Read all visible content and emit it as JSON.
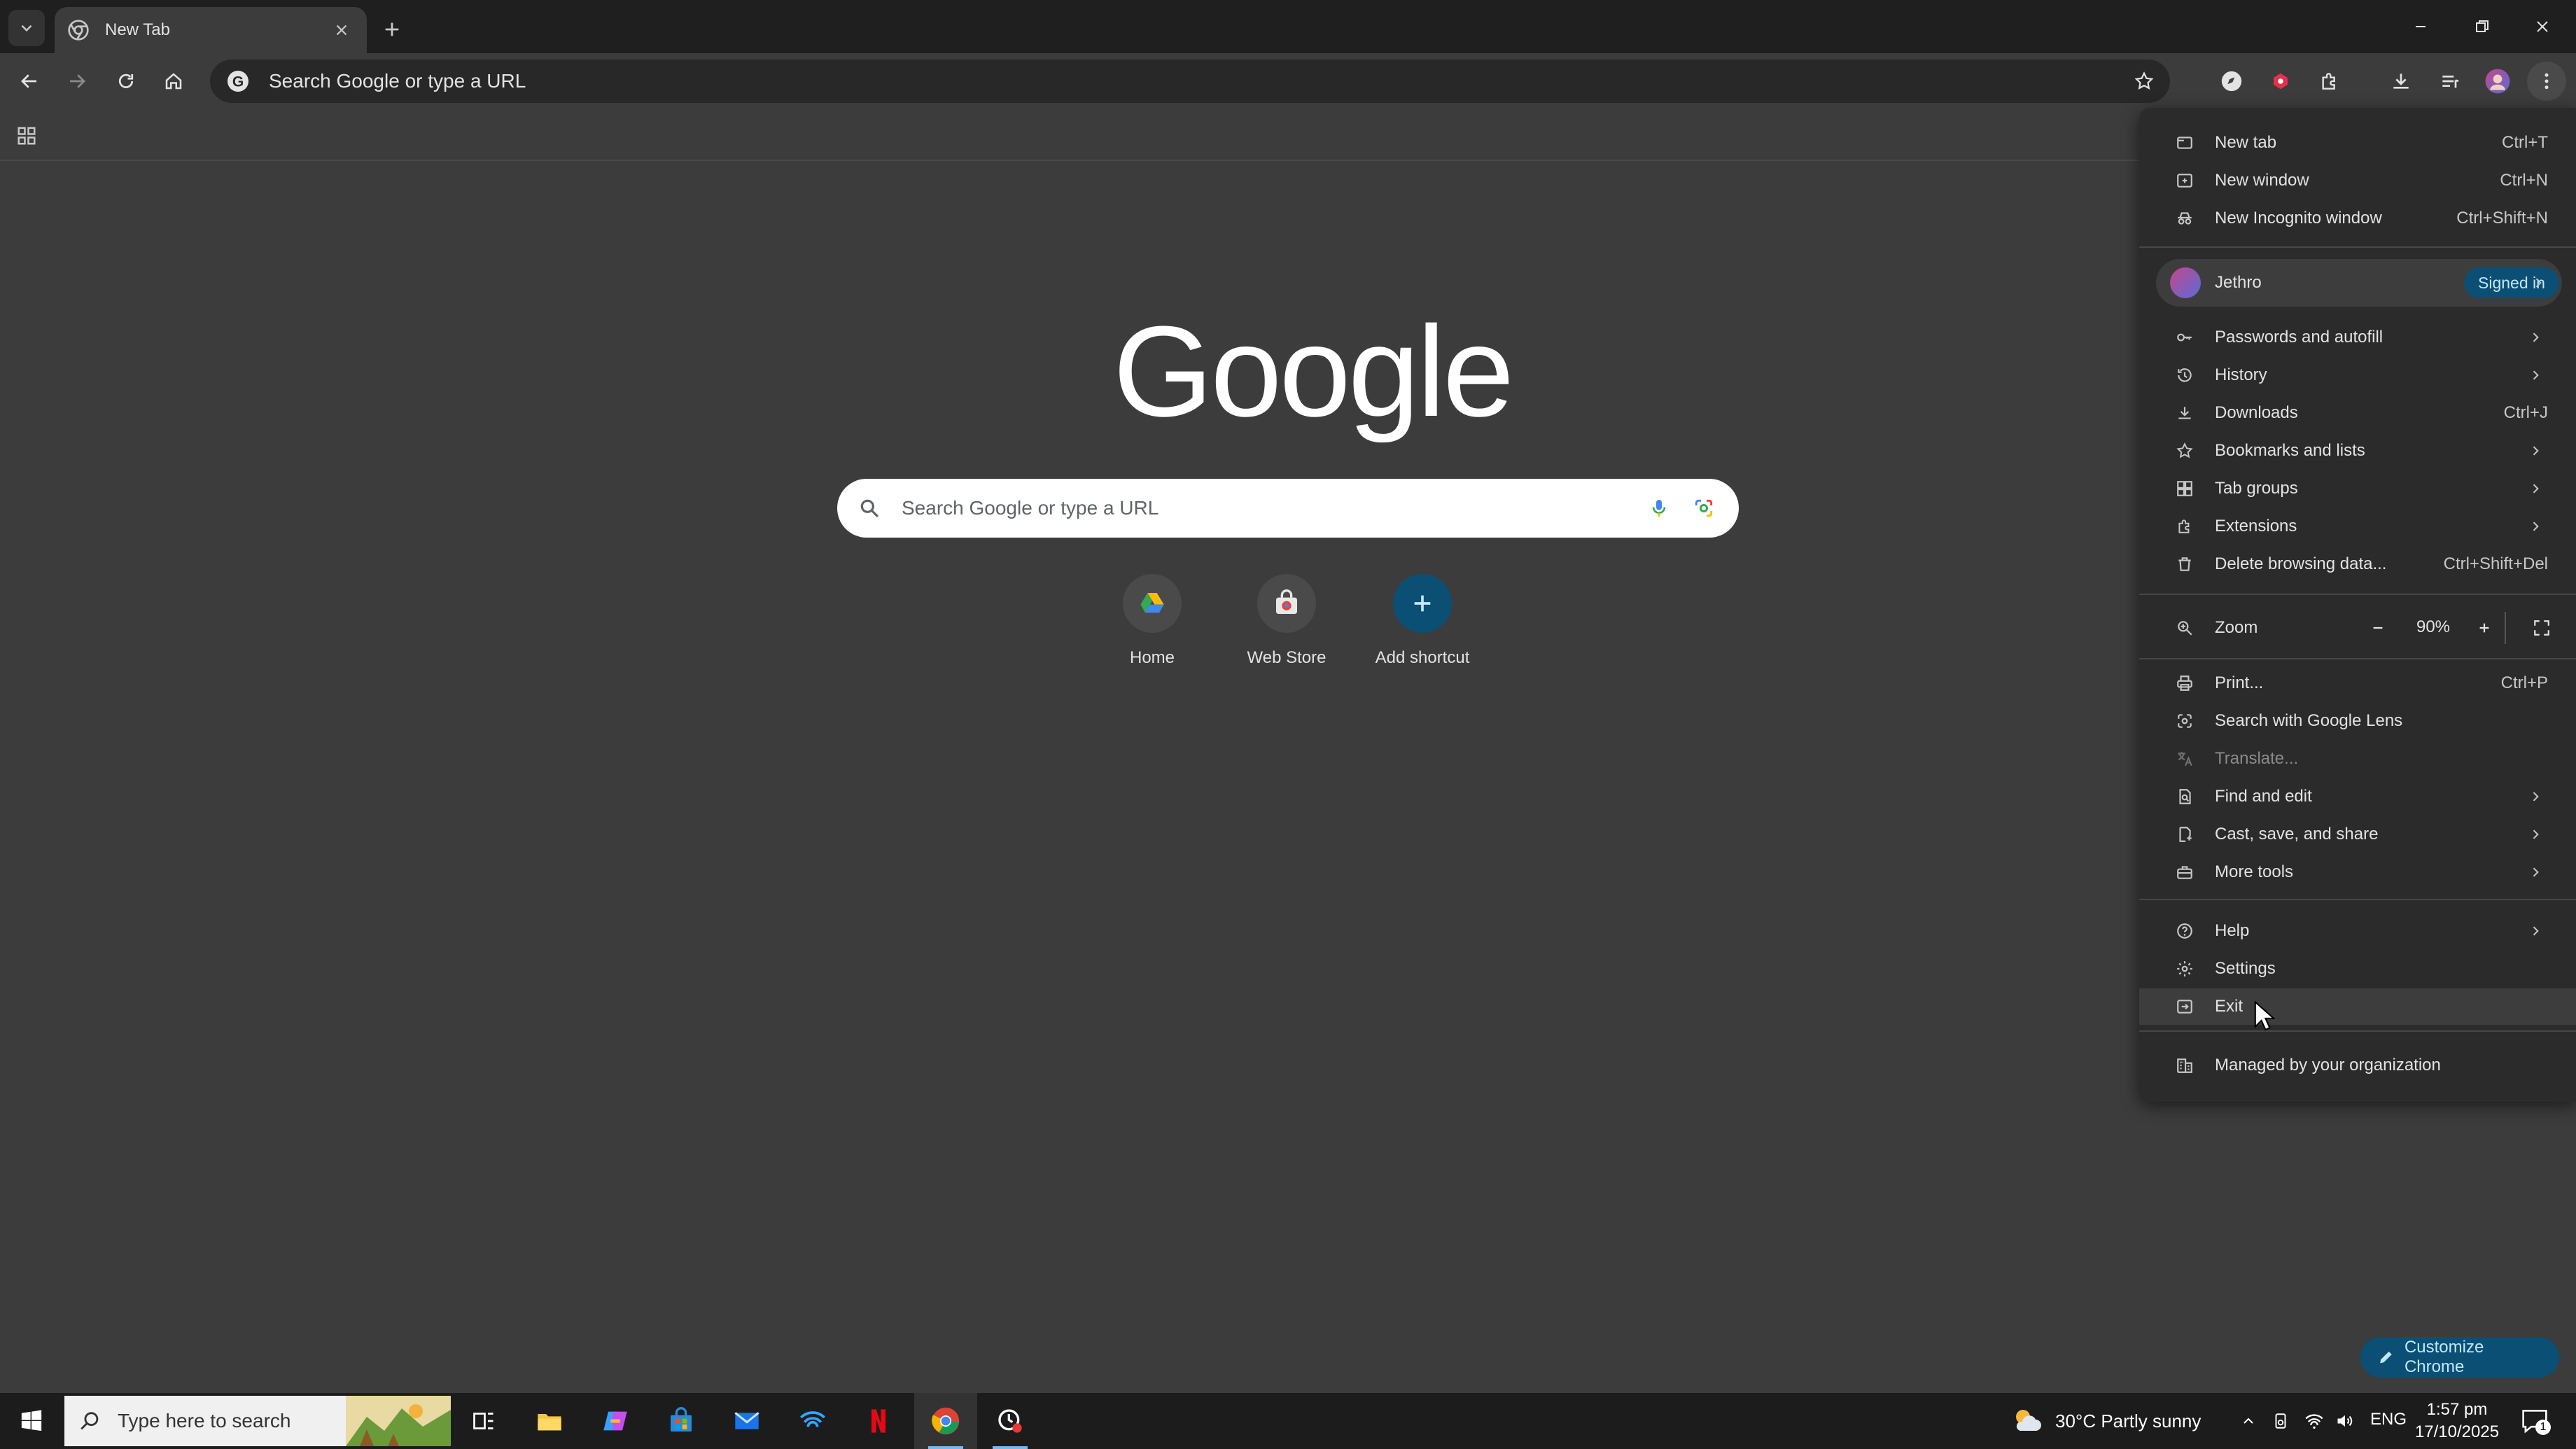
{
  "colors": {
    "frame": "#1f1f1f",
    "toolbar": "#3c3c3c",
    "page": "#3c3c3c",
    "menu": "#2b2b2b",
    "accent": "#0b4f74",
    "accent_text": "#c2e7ff"
  },
  "tab": {
    "title": "New Tab"
  },
  "omnibox": {
    "text": "Search Google or type a URL"
  },
  "ntp": {
    "logo": "Google",
    "search_placeholder": "Search Google or type a URL",
    "shortcuts": [
      {
        "label": "Home",
        "icon": "google-drive-icon"
      },
      {
        "label": "Web Store",
        "icon": "web-store-icon"
      },
      {
        "label": "Add shortcut",
        "icon": "plus-icon"
      }
    ],
    "customize_label": "Customize Chrome"
  },
  "menu": {
    "group1": [
      {
        "label": "New tab",
        "shortcut": "Ctrl+T",
        "icon": "new-tab-icon"
      },
      {
        "label": "New window",
        "shortcut": "Ctrl+N",
        "icon": "new-window-icon"
      },
      {
        "label": "New Incognito window",
        "shortcut": "Ctrl+Shift+N",
        "icon": "incognito-icon"
      }
    ],
    "profile": {
      "name": "Jethro",
      "badge": "Signed in"
    },
    "group2": [
      {
        "label": "Passwords and autofill",
        "shortcut": "",
        "icon": "key-icon"
      },
      {
        "label": "History",
        "shortcut": "",
        "icon": "history-icon"
      },
      {
        "label": "Downloads",
        "shortcut": "Ctrl+J",
        "icon": "download-icon"
      },
      {
        "label": "Bookmarks and lists",
        "shortcut": "",
        "icon": "star-icon"
      },
      {
        "label": "Tab groups",
        "shortcut": "",
        "icon": "tab-groups-icon"
      },
      {
        "label": "Extensions",
        "shortcut": "",
        "icon": "puzzle-icon"
      },
      {
        "label": "Delete browsing data...",
        "shortcut": "Ctrl+Shift+Del",
        "icon": "trash-icon"
      }
    ],
    "zoom": {
      "label": "Zoom",
      "value": "90%"
    },
    "group3": [
      {
        "label": "Print...",
        "shortcut": "Ctrl+P",
        "icon": "print-icon"
      },
      {
        "label": "Search with Google Lens",
        "shortcut": "",
        "icon": "lens-icon"
      },
      {
        "label": "Translate...",
        "shortcut": "",
        "icon": "translate-icon"
      },
      {
        "label": "Find and edit",
        "shortcut": "",
        "icon": "find-icon"
      },
      {
        "label": "Cast, save, and share",
        "shortcut": "",
        "icon": "cast-icon"
      },
      {
        "label": "More tools",
        "shortcut": "",
        "icon": "toolbox-icon"
      }
    ],
    "group4": [
      {
        "label": "Help",
        "shortcut": "",
        "icon": "help-icon"
      },
      {
        "label": "Settings",
        "shortcut": "",
        "icon": "gear-icon"
      },
      {
        "label": "Exit",
        "shortcut": "",
        "icon": "exit-icon"
      }
    ],
    "managed": {
      "label": "Managed by your organization",
      "icon": "building-icon"
    }
  },
  "taskbar": {
    "search_placeholder": "Type here to search",
    "weather": "30°C  Partly sunny",
    "language": "ENG",
    "time": "1:57 pm",
    "date": "17/10/2025",
    "notification_count": "1"
  }
}
